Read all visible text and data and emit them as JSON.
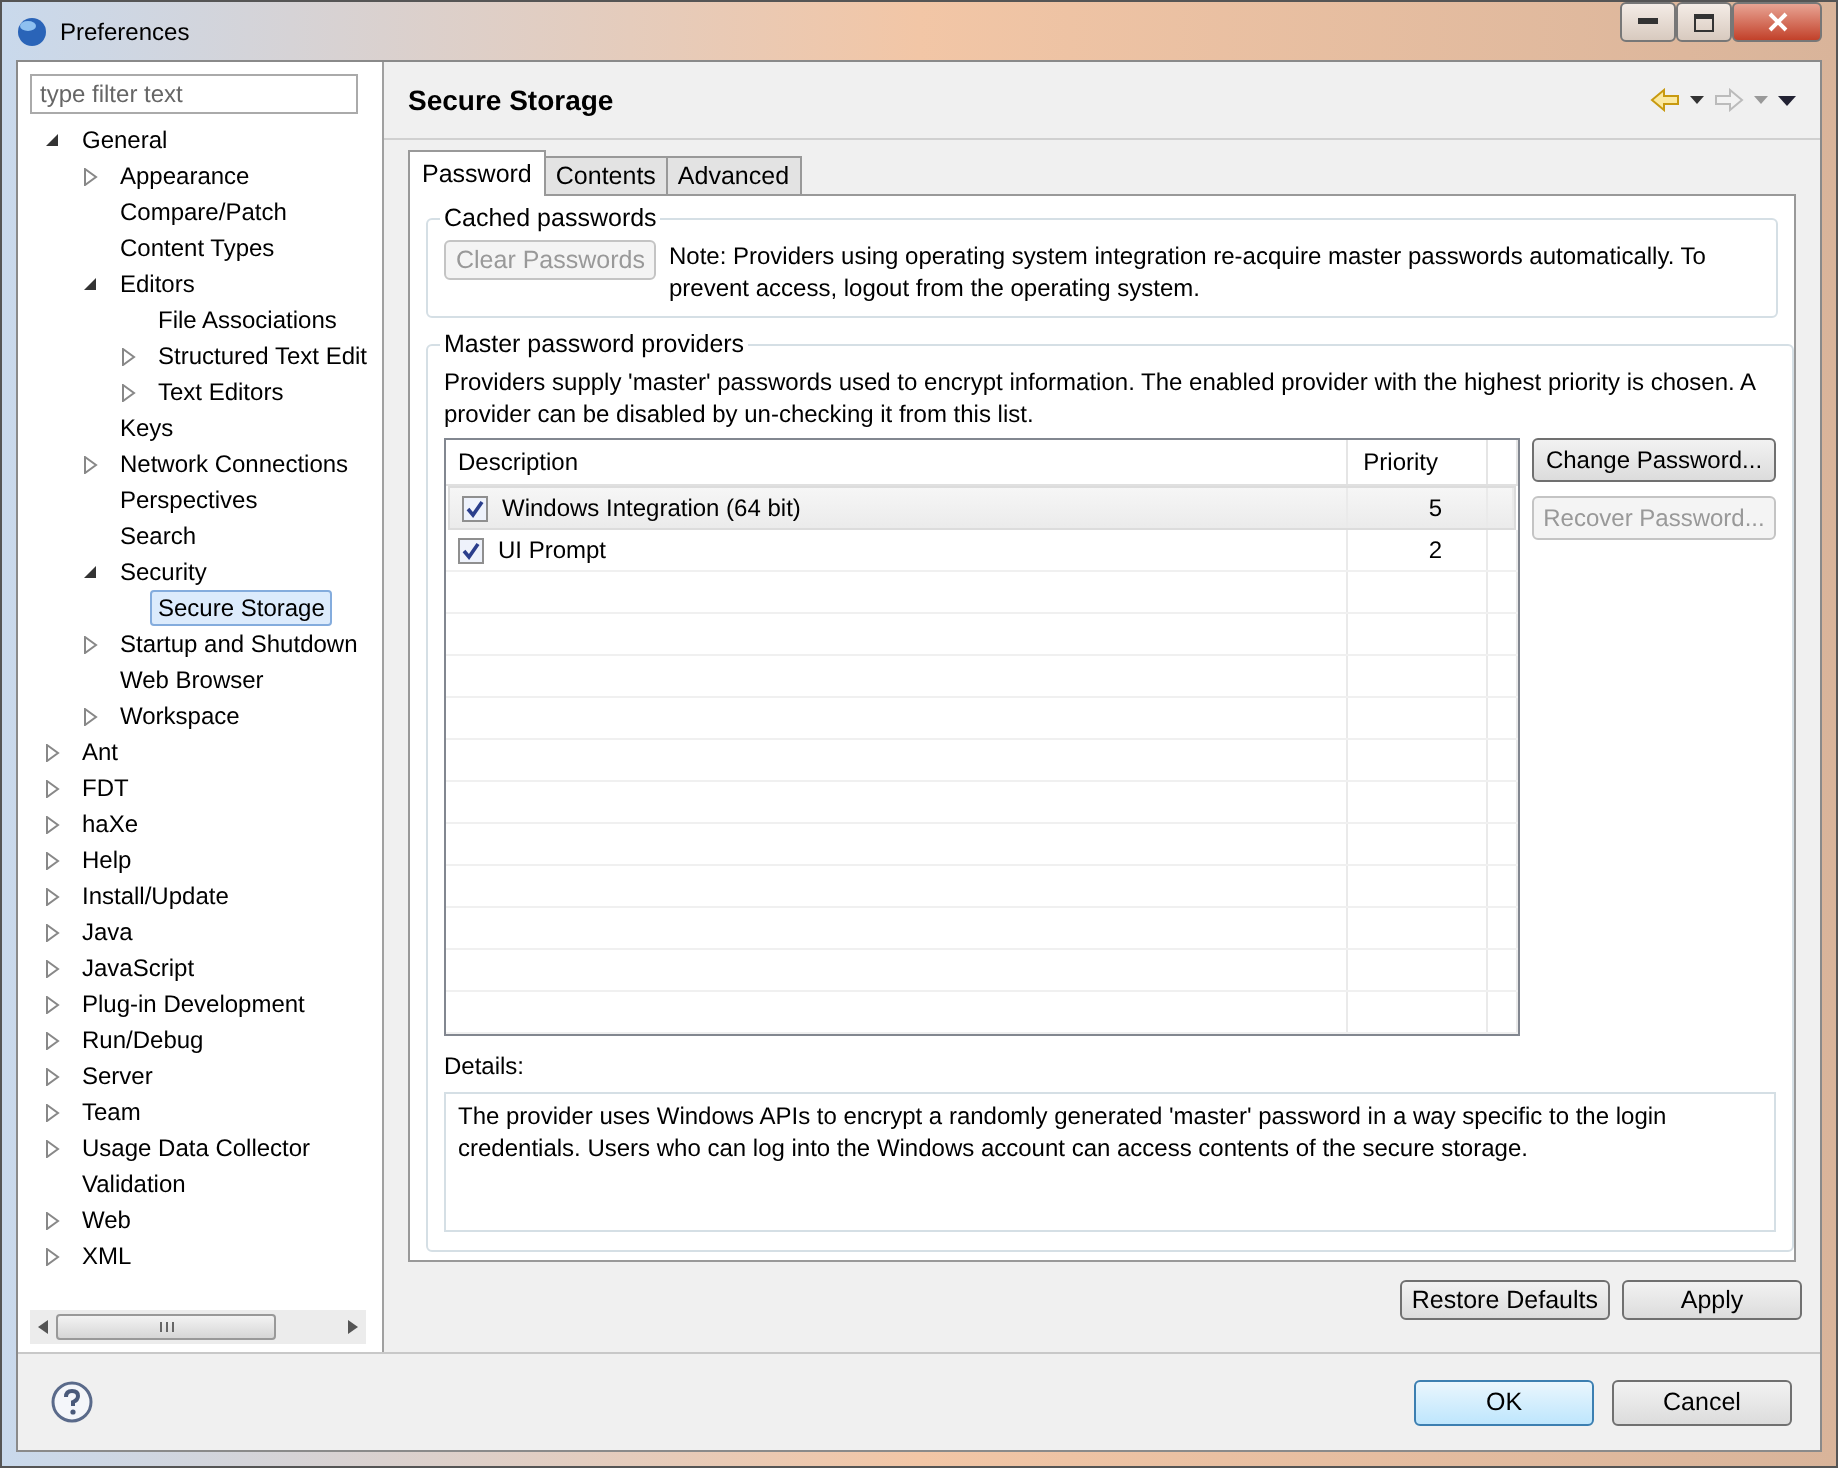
{
  "window": {
    "title": "Preferences"
  },
  "filter": {
    "placeholder": "type filter text"
  },
  "tree": [
    {
      "label": "General",
      "expanded": true,
      "selected": false,
      "children": [
        {
          "label": "Appearance",
          "expanded": false,
          "selected": false
        },
        {
          "label": "Compare/Patch",
          "selected": false
        },
        {
          "label": "Content Types",
          "selected": false
        },
        {
          "label": "Editors",
          "expanded": true,
          "selected": false,
          "children": [
            {
              "label": "File Associations",
              "selected": false
            },
            {
              "label": "Structured Text Edit",
              "expanded": false,
              "selected": false
            },
            {
              "label": "Text Editors",
              "expanded": false,
              "selected": false
            }
          ]
        },
        {
          "label": "Keys",
          "selected": false
        },
        {
          "label": "Network Connections",
          "expanded": false,
          "selected": false
        },
        {
          "label": "Perspectives",
          "selected": false
        },
        {
          "label": "Search",
          "selected": false
        },
        {
          "label": "Security",
          "expanded": true,
          "selected": false,
          "children": [
            {
              "label": "Secure Storage",
              "selected": true
            }
          ]
        },
        {
          "label": "Startup and Shutdown",
          "expanded": false,
          "selected": false
        },
        {
          "label": "Web Browser",
          "selected": false
        },
        {
          "label": "Workspace",
          "expanded": false,
          "selected": false
        }
      ]
    },
    {
      "label": "Ant",
      "expanded": false,
      "selected": false
    },
    {
      "label": "FDT",
      "expanded": false,
      "selected": false
    },
    {
      "label": "haXe",
      "expanded": false,
      "selected": false
    },
    {
      "label": "Help",
      "expanded": false,
      "selected": false
    },
    {
      "label": "Install/Update",
      "expanded": false,
      "selected": false
    },
    {
      "label": "Java",
      "expanded": false,
      "selected": false
    },
    {
      "label": "JavaScript",
      "expanded": false,
      "selected": false
    },
    {
      "label": "Plug-in Development",
      "expanded": false,
      "selected": false
    },
    {
      "label": "Run/Debug",
      "expanded": false,
      "selected": false
    },
    {
      "label": "Server",
      "expanded": false,
      "selected": false
    },
    {
      "label": "Team",
      "expanded": false,
      "selected": false
    },
    {
      "label": "Usage Data Collector",
      "expanded": false,
      "selected": false
    },
    {
      "label": "Validation",
      "selected": false
    },
    {
      "label": "Web",
      "expanded": false,
      "selected": false
    },
    {
      "label": "XML",
      "expanded": false,
      "selected": false
    }
  ],
  "page": {
    "title": "Secure Storage"
  },
  "tabs": [
    {
      "label": "Password",
      "selected": true
    },
    {
      "label": "Contents",
      "selected": false
    },
    {
      "label": "Advanced",
      "selected": false
    }
  ],
  "cached": {
    "legend": "Cached passwords",
    "button": {
      "label": "Clear Passwords",
      "disabled": true
    },
    "note": "Note: Providers using operating system integration re-acquire master passwords automatically. To prevent access, logout from the operating system."
  },
  "providers": {
    "legend": "Master password providers",
    "intro": "Providers supply 'master' passwords used to encrypt information. The enabled provider with the highest priority is chosen. A provider can be disabled by un-checking it from this list.",
    "columns": [
      "Description",
      "Priority"
    ],
    "rows": [
      {
        "description": "Windows Integration (64 bit)",
        "priority": "5",
        "checked": true,
        "selected": true
      },
      {
        "description": "UI Prompt",
        "priority": "2",
        "checked": true,
        "selected": false
      }
    ],
    "buttons": [
      {
        "label": "Change Password...",
        "disabled": false
      },
      {
        "label": "Recover Password...",
        "disabled": true
      }
    ],
    "details_label": "Details:",
    "details": "The provider uses Windows APIs to encrypt a randomly generated 'master' password in a way specific to the login credentials. Users who can log into the Windows account can access contents of the secure storage."
  },
  "page_buttons": [
    "Restore Defaults",
    "Apply"
  ],
  "dialog_buttons": [
    {
      "label": "OK",
      "default": true
    },
    {
      "label": "Cancel",
      "default": false
    }
  ]
}
